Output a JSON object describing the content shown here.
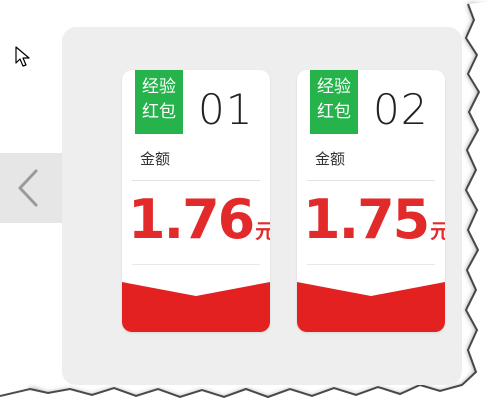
{
  "cards": [
    {
      "tag_line1": "经验",
      "tag_line2": "红包",
      "number": "01",
      "amount_label": "金额",
      "amount": "1.76",
      "unit": "元"
    },
    {
      "tag_line1": "经验",
      "tag_line2": "红包",
      "number": "02",
      "amount_label": "金额",
      "amount": "1.75",
      "unit": "元"
    }
  ],
  "colors": {
    "tag_green": "#27b34b",
    "amount_red": "#e22a2a",
    "band_red": "#e42121",
    "panel_gray": "#eeeeee"
  },
  "icons": {
    "prev": "chevron-left-icon",
    "cursor": "mouse-pointer-icon"
  }
}
